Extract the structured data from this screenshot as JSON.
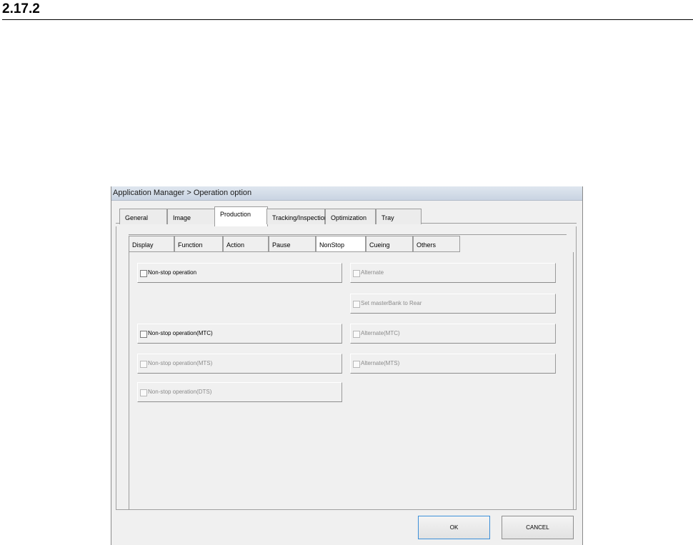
{
  "section": {
    "heading": "2.17.2"
  },
  "window": {
    "title": "Application Manager > Operation option"
  },
  "tabs": [
    "General",
    "Image",
    "Production",
    "Tracking/Inspection",
    "Optimization",
    "Tray"
  ],
  "active_tab": "Production",
  "subtabs": [
    "Display",
    "Function",
    "Action",
    "Pause",
    "NonStop",
    "Cueing",
    "Others"
  ],
  "active_subtab": "NonStop",
  "options_left": [
    {
      "label": "Non-stop operation",
      "enabled": true,
      "checked": false
    },
    {
      "label": "Non-stop operation(MTC)",
      "enabled": true,
      "checked": false
    },
    {
      "label": "Non-stop operation(MTS)",
      "enabled": false,
      "checked": false
    },
    {
      "label": "Non-stop operation(DTS)",
      "enabled": false,
      "checked": false
    }
  ],
  "options_right": [
    {
      "label": "Alternate",
      "enabled": false,
      "checked": false
    },
    {
      "label": "Set masterBank to Rear",
      "enabled": false,
      "checked": false
    },
    {
      "label": "Alternate(MTC)",
      "enabled": false,
      "checked": false
    },
    {
      "label": "Alternate(MTS)",
      "enabled": false,
      "checked": false
    }
  ],
  "buttons": {
    "ok": "OK",
    "cancel": "CANCEL"
  }
}
